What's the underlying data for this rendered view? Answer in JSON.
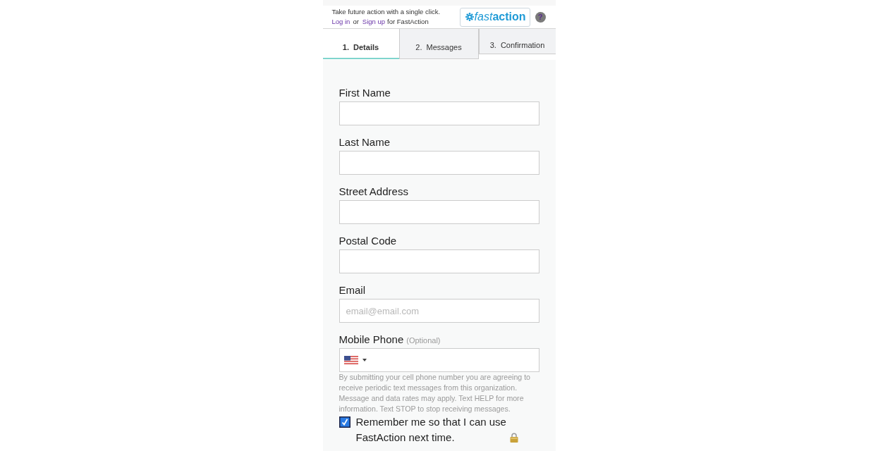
{
  "header": {
    "tagline": "Take future action with a single click.",
    "login_link": "Log in",
    "or_text": "or",
    "signup_link": "Sign up",
    "for_text": "for FastAction",
    "logo": {
      "light_part": "fast",
      "bold_part": "action"
    },
    "help": "?"
  },
  "tabs": [
    {
      "number": "1.",
      "label": "Details",
      "selected": true,
      "hovered": false
    },
    {
      "number": "2.",
      "label": "Messages",
      "selected": false,
      "hovered": true
    },
    {
      "number": "3.",
      "label": "Confirmation",
      "selected": false,
      "hovered": false
    }
  ],
  "fields": [
    {
      "kind": "text",
      "label": "First Name"
    },
    {
      "kind": "text",
      "label": "Last Name"
    },
    {
      "kind": "text",
      "label": "Street Address"
    },
    {
      "kind": "text",
      "label": "Postal Code"
    },
    {
      "kind": "text",
      "label": "Email",
      "placeholder": "email@email.com"
    },
    {
      "kind": "phone",
      "label": "Mobile Phone",
      "note": "(Optional)"
    }
  ],
  "phone_disclaimer": "By submitting your cell phone number you are agreeing to receive periodic text messages from this organization. Message and data rates may apply. Text HELP for more information. Text STOP to stop receiving messages.",
  "remember": {
    "checked": true,
    "label": "Remember me so that I can use FastAction next time."
  }
}
